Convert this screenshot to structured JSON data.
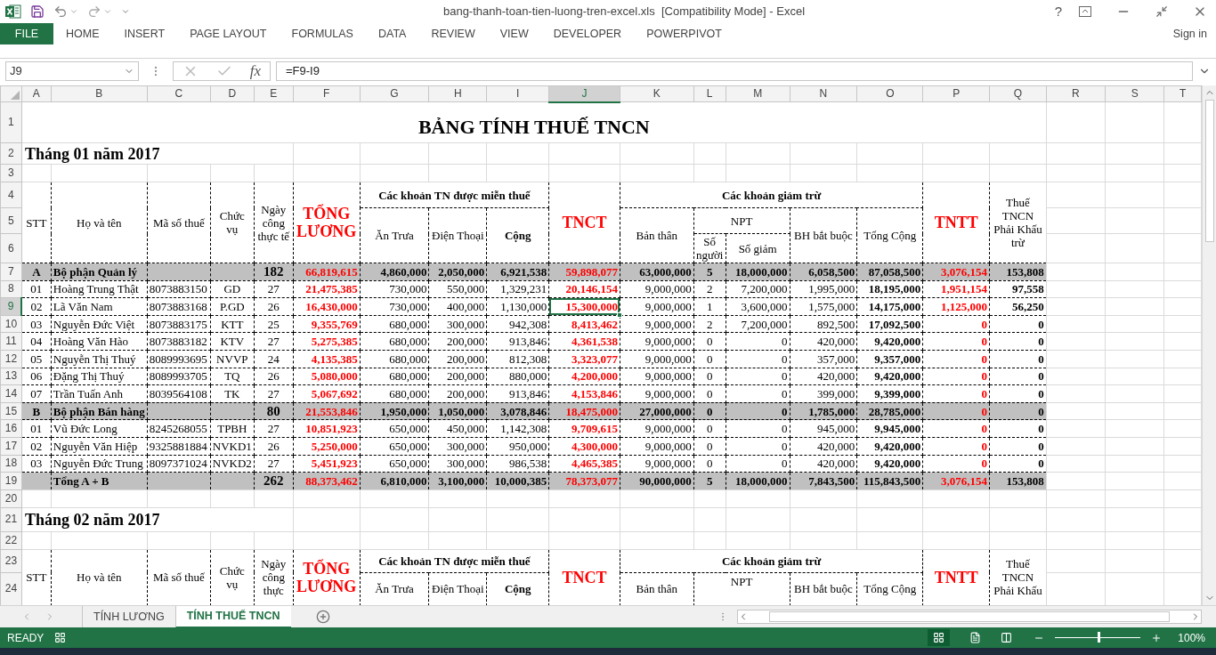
{
  "window": {
    "title": "bang-thanh-toan-tien-luong-tren-excel.xls  [Compatibility Mode] - Excel",
    "help": "?"
  },
  "ribbon": {
    "file_tab": "FILE",
    "tabs": [
      "HOME",
      "INSERT",
      "PAGE LAYOUT",
      "FORMULAS",
      "DATA",
      "REVIEW",
      "VIEW",
      "DEVELOPER",
      "POWERPIVOT"
    ],
    "sign_in": "Sign in"
  },
  "formula_bar": {
    "name_box": "J9",
    "function_button": "fx",
    "formula": "=F9-I9"
  },
  "columns": [
    {
      "label": "A",
      "selected": false
    },
    {
      "label": "B",
      "selected": false
    },
    {
      "label": "C",
      "selected": false
    },
    {
      "label": "D",
      "selected": false
    },
    {
      "label": "E",
      "selected": false
    },
    {
      "label": "F",
      "selected": false
    },
    {
      "label": "G",
      "selected": false
    },
    {
      "label": "H",
      "selected": false
    },
    {
      "label": "I",
      "selected": false
    },
    {
      "label": "J",
      "selected": true
    },
    {
      "label": "K",
      "selected": false
    },
    {
      "label": "L",
      "selected": false
    },
    {
      "label": "M",
      "selected": false
    },
    {
      "label": "N",
      "selected": false
    },
    {
      "label": "O",
      "selected": false
    },
    {
      "label": "P",
      "selected": false
    },
    {
      "label": "Q",
      "selected": false
    },
    {
      "label": "R",
      "selected": false
    },
    {
      "label": "S",
      "selected": false
    },
    {
      "label": "T",
      "selected": false
    }
  ],
  "row_numbers": [
    {
      "label": "1",
      "selected": false
    },
    {
      "label": "2",
      "selected": false
    },
    {
      "label": "3",
      "selected": false
    },
    {
      "label": "4",
      "selected": false
    },
    {
      "label": "5",
      "selected": false
    },
    {
      "label": "6",
      "selected": false
    },
    {
      "label": "7",
      "selected": false
    },
    {
      "label": "8",
      "selected": false
    },
    {
      "label": "9",
      "selected": true
    },
    {
      "label": "10",
      "selected": false
    },
    {
      "label": "11",
      "selected": false
    },
    {
      "label": "12",
      "selected": false
    },
    {
      "label": "13",
      "selected": false
    },
    {
      "label": "14",
      "selected": false
    },
    {
      "label": "15",
      "selected": false
    },
    {
      "label": "16",
      "selected": false
    },
    {
      "label": "17",
      "selected": false
    },
    {
      "label": "18",
      "selected": false
    },
    {
      "label": "19",
      "selected": false
    },
    {
      "label": "20",
      "selected": false
    },
    {
      "label": "21",
      "selected": false
    },
    {
      "label": "22",
      "selected": false
    },
    {
      "label": "23",
      "selected": false
    },
    {
      "label": "24",
      "selected": false
    }
  ],
  "sheet": {
    "title": "BẢNG TÍNH THUẾ TNCN",
    "sections": [
      {
        "heading": "Tháng 01 năm 2017",
        "header": {
          "stt": "STT",
          "name": "Họ và tên",
          "tax_code": "Mã số thuế",
          "position": "Chức vụ",
          "days": "Ngày công thực tế",
          "total_salary": "TỔNG LƯƠNG",
          "exempt": "Các khoản TN được miễn thuế",
          "lunch": "Ăn Trưa",
          "phone": "Điện Thoại",
          "exempt_total": "Cộng",
          "tnct": "TNCT",
          "deductions": "Các khoản giảm trừ",
          "self": "Bản thân",
          "npt": "NPT",
          "dependents": "Số người",
          "dependents_amount": "Số giảm",
          "insurance": "BH bắt buộc",
          "deductions_total": "Tổng Cộng",
          "tntt": "TNTT",
          "tax": "Thuế TNCN Phải Khấu trừ"
        },
        "rows": [
          {
            "kind": "group",
            "cells": [
              "A",
              "Bộ phận Quản lý",
              null,
              null,
              "182",
              "66,819,615",
              "4,860,000",
              "2,050,000",
              "6,921,538",
              "59,898,077",
              "63,000,000",
              "5",
              "18,000,000",
              "6,058,500",
              "87,058,500",
              "3,076,154",
              "153,808"
            ]
          },
          {
            "kind": "employee",
            "cells": [
              "01",
              "Hoàng Trung Thật",
              "8073883150",
              "GD",
              "27",
              "21,475,385",
              "730,000",
              "550,000",
              "1,329,231",
              "20,146,154",
              "9,000,000",
              "2",
              "7,200,000",
              "1,995,000",
              "18,195,000",
              "1,951,154",
              "97,558"
            ]
          },
          {
            "kind": "employee",
            "cells": [
              "02",
              "Lã Văn Nam",
              "8073883168",
              "P.GD",
              "26",
              "16,430,000",
              "730,000",
              "400,000",
              "1,130,000",
              "15,300,000",
              "9,000,000",
              "1",
              "3,600,000",
              "1,575,000",
              "14,175,000",
              "1,125,000",
              "56,250"
            ]
          },
          {
            "kind": "employee",
            "cells": [
              "03",
              "Nguyễn Đức Việt",
              "8073883175",
              "KTT",
              "25",
              "9,355,769",
              "680,000",
              "300,000",
              "942,308",
              "8,413,462",
              "9,000,000",
              "2",
              "7,200,000",
              "892,500",
              "17,092,500",
              "0",
              "0"
            ]
          },
          {
            "kind": "employee",
            "cells": [
              "04",
              "Hoàng Văn Hào",
              "8073883182",
              "KTV",
              "27",
              "5,275,385",
              "680,000",
              "200,000",
              "913,846",
              "4,361,538",
              "9,000,000",
              "0",
              "0",
              "420,000",
              "9,420,000",
              "0",
              "0"
            ]
          },
          {
            "kind": "employee",
            "cells": [
              "05",
              "Nguyễn Thị Thuý",
              "8089993695",
              "NVVP",
              "24",
              "4,135,385",
              "680,000",
              "200,000",
              "812,308",
              "3,323,077",
              "9,000,000",
              "0",
              "0",
              "357,000",
              "9,357,000",
              "0",
              "0"
            ]
          },
          {
            "kind": "employee",
            "cells": [
              "06",
              "Đặng Thị Thuý",
              "8089993705",
              "TQ",
              "26",
              "5,080,000",
              "680,000",
              "200,000",
              "880,000",
              "4,200,000",
              "9,000,000",
              "0",
              "0",
              "420,000",
              "9,420,000",
              "0",
              "0"
            ]
          },
          {
            "kind": "employee",
            "cells": [
              "07",
              "Trần Tuấn Anh",
              "8039564108",
              "TK",
              "27",
              "5,067,692",
              "680,000",
              "200,000",
              "913,846",
              "4,153,846",
              "9,000,000",
              "0",
              "0",
              "399,000",
              "9,399,000",
              "0",
              "0"
            ]
          },
          {
            "kind": "group",
            "cells": [
              "B",
              "Bộ phận Bán hàng",
              null,
              null,
              "80",
              "21,553,846",
              "1,950,000",
              "1,050,000",
              "3,078,846",
              "18,475,000",
              "27,000,000",
              "0",
              "0",
              "1,785,000",
              "28,785,000",
              "0",
              "0"
            ]
          },
          {
            "kind": "employee",
            "cells": [
              "01",
              "Vũ Đức Long",
              "8245268055",
              "TPBH",
              "27",
              "10,851,923",
              "650,000",
              "450,000",
              "1,142,308",
              "9,709,615",
              "9,000,000",
              "0",
              "0",
              "945,000",
              "9,945,000",
              "0",
              "0"
            ]
          },
          {
            "kind": "employee",
            "cells": [
              "02",
              "Nguyễn Văn Hiệp",
              "9325881884",
              "NVKD1",
              "26",
              "5,250,000",
              "650,000",
              "300,000",
              "950,000",
              "4,300,000",
              "9,000,000",
              "0",
              "0",
              "420,000",
              "9,420,000",
              "0",
              "0"
            ]
          },
          {
            "kind": "employee",
            "cells": [
              "03",
              "Nguyễn Đức Trung",
              "8097371024",
              "NVKD2",
              "27",
              "5,451,923",
              "650,000",
              "300,000",
              "986,538",
              "4,465,385",
              "9,000,000",
              "0",
              "0",
              "420,000",
              "9,420,000",
              "0",
              "0"
            ]
          },
          {
            "kind": "group",
            "cells": [
              null,
              "Tổng A + B",
              null,
              null,
              "262",
              "88,373,462",
              "6,810,000",
              "3,100,000",
              "10,000,385",
              "78,373,077",
              "90,000,000",
              "5",
              "18,000,000",
              "7,843,500",
              "115,843,500",
              "3,076,154",
              "153,808"
            ]
          }
        ]
      },
      {
        "heading": "Tháng 02 năm 2017",
        "header": {
          "stt": "STT",
          "name": "Họ và tên",
          "tax_code": "Mã số thuế",
          "position": "Chức vụ",
          "days": "Ngày công thực",
          "total_salary": "TỔNG LƯƠNG",
          "exempt": "Các khoản TN được miễn thuế",
          "lunch": "Ăn Trưa",
          "phone": "Điện Thoại",
          "exempt_total": "Cộng",
          "tnct": "TNCT",
          "deductions": "Các khoản giảm trừ",
          "self": "Bản thân",
          "npt": "NPT",
          "insurance": "BH bắt buộc",
          "deductions_total": "Tổng Cộng",
          "tntt": "TNTT",
          "tax": "Thuế TNCN Phải Khấu"
        }
      }
    ]
  },
  "sheet_tabs": [
    {
      "label": "TÍNH LƯƠNG",
      "selected": false
    },
    {
      "label": "TÍNH THUẾ TNCN",
      "selected": true
    }
  ],
  "status_bar": {
    "ready": "READY",
    "zoom": "100%",
    "zoom_slider": {
      "level": 0.5
    }
  }
}
